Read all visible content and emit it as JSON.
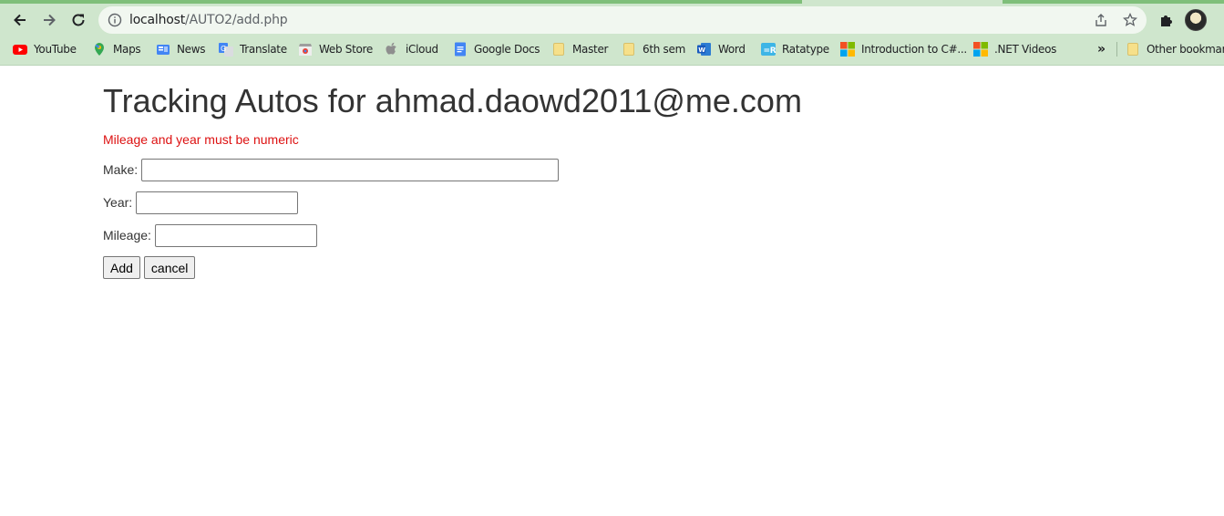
{
  "browser": {
    "url_host": "localhost",
    "url_path": "/AUTO2/add.php",
    "bookmarks": [
      {
        "label": "YouTube",
        "icon": "youtube-icon"
      },
      {
        "label": "Maps",
        "icon": "maps-icon"
      },
      {
        "label": "News",
        "icon": "news-icon"
      },
      {
        "label": "Translate",
        "icon": "translate-icon"
      },
      {
        "label": "Web Store",
        "icon": "web-store-icon"
      },
      {
        "label": "iCloud",
        "icon": "apple-icon"
      },
      {
        "label": "Google Docs",
        "icon": "docs-icon"
      },
      {
        "label": "Master",
        "icon": "folder-icon"
      },
      {
        "label": "6th sem",
        "icon": "folder-icon"
      },
      {
        "label": "Word",
        "icon": "word-icon"
      },
      {
        "label": "Ratatype",
        "icon": "ratatype-icon"
      },
      {
        "label": "Introduction to C#...",
        "icon": "microsoft-icon"
      },
      {
        "label": ".NET Videos",
        "icon": "microsoft-icon"
      }
    ],
    "overflow_label": "»",
    "other_bookmarks": "Other bookmarks"
  },
  "page": {
    "title": "Tracking Autos for ahmad.daowd2011@me.com",
    "error": "Mileage and year must be numeric",
    "fields": {
      "make_label": "Make:",
      "make_value": "",
      "year_label": "Year:",
      "year_value": "",
      "mileage_label": "Mileage:",
      "mileage_value": ""
    },
    "buttons": {
      "add": "Add",
      "cancel": "cancel"
    }
  },
  "colors": {
    "chrome": "#cfe6cd",
    "error": "#dd1111",
    "heading": "#333333"
  }
}
